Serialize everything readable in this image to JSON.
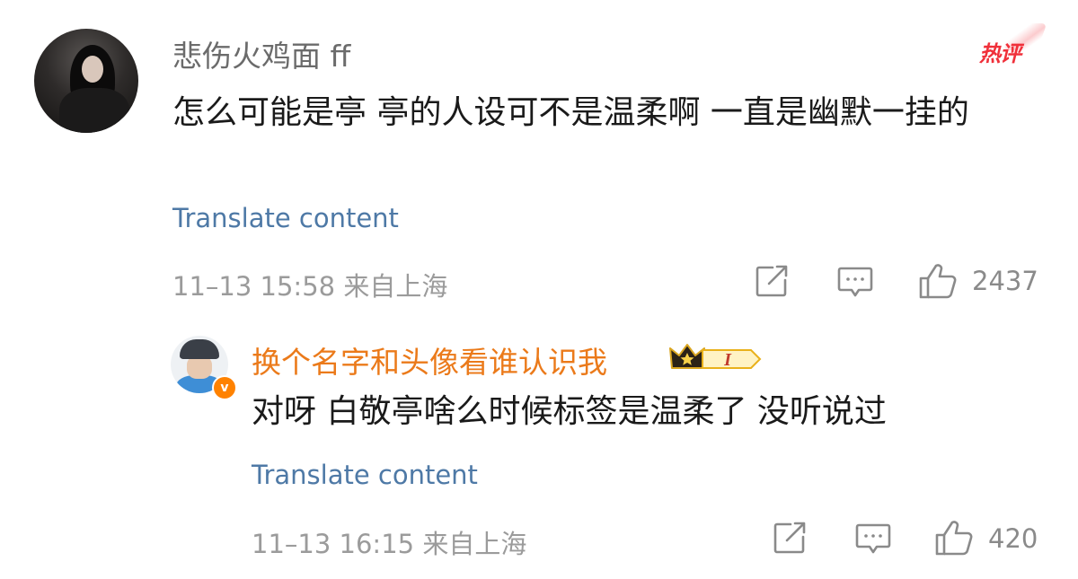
{
  "comment1": {
    "username": "悲伤火鸡面 ff",
    "hot_badge": "热评",
    "text": "怎么可能是亭 亭的人设可不是温柔啊 一直是幽默一挂的",
    "translate": "Translate content",
    "timestamp": "11–13 15:58 来自上海",
    "likes": "2437"
  },
  "reply": {
    "username": "换个名字和头像看谁认识我",
    "verified_badge": "v",
    "vip_level": "I",
    "text": "对呀 白敬亭啥么时候标签是温柔了 没听说过",
    "translate": "Translate content",
    "timestamp": "11–13 16:15 来自上海",
    "likes": "420"
  },
  "colors": {
    "username_gray": "#6b6b6b",
    "username_orange": "#eb7a1a",
    "link_blue": "#4e79a6",
    "hot_red": "#f0303a",
    "meta_gray": "#9b9b9b"
  },
  "icons": [
    "share-icon",
    "comment-icon",
    "like-icon",
    "crown-icon",
    "verified-icon"
  ]
}
